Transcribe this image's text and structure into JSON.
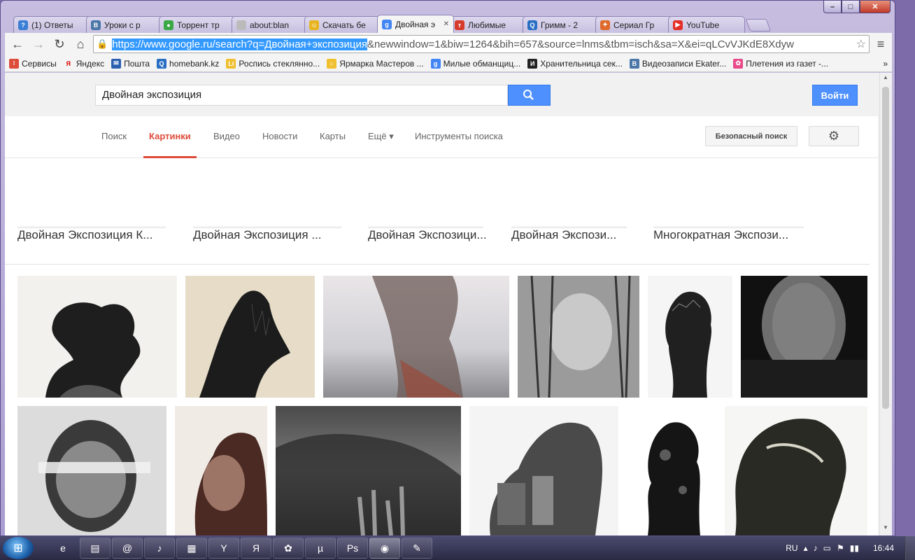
{
  "tabs": [
    {
      "title": "(1) Ответы",
      "icon": "question-icon",
      "icon_color": "#3a7fd5",
      "icon_text": "?"
    },
    {
      "title": "Уроки с р",
      "icon": "vk-icon",
      "icon_color": "#4a76a8",
      "icon_text": "В"
    },
    {
      "title": "Торрент тр",
      "icon": "torrent-icon",
      "icon_color": "#3aa845",
      "icon_text": "●"
    },
    {
      "title": "about:blan",
      "icon": "page-icon",
      "icon_color": "#bbbbbb",
      "icon_text": ""
    },
    {
      "title": "Скачать бе",
      "icon": "smiley-icon",
      "icon_color": "#e8b520",
      "icon_text": "☺"
    },
    {
      "title": "Двойная э",
      "icon": "google-icon",
      "icon_color": "#4285f4",
      "icon_text": "g",
      "active": true
    },
    {
      "title": "Любимые",
      "icon": "t-icon",
      "icon_color": "#d63a2a",
      "icon_text": "т"
    },
    {
      "title": "Гримм - 2",
      "icon": "search-site-icon",
      "icon_color": "#2a6fc4",
      "icon_text": "Q"
    },
    {
      "title": "Сериал Гр",
      "icon": "fox-icon",
      "icon_color": "#e06a2a",
      "icon_text": "✦"
    },
    {
      "title": "YouTube",
      "icon": "youtube-icon",
      "icon_color": "#e52d27",
      "icon_text": "▶"
    }
  ],
  "window_controls": {
    "min": "–",
    "max": "□",
    "close": "✕"
  },
  "toolbar": {
    "back": "←",
    "forward": "→",
    "reload": "↻",
    "home": "⌂",
    "url_selected": "https://www.google.ru/search?q=Двойная+экспозиция",
    "url_rest": "&newwindow=1&biw=1264&bih=657&source=lnms&tbm=isch&sa=X&ei=qLCvVJKdE8Xdyw",
    "lock": "🔒",
    "star": "☆",
    "menu": "≡"
  },
  "bookmarks": [
    {
      "label": "Сервисы",
      "icon": "apps-icon",
      "icon_color": "#dd4b39",
      "icon_text": "⁝"
    },
    {
      "label": "Яндекс",
      "icon": "yandex-icon",
      "icon_color": "#f5f5f5",
      "icon_text": "Я"
    },
    {
      "label": "Пошта",
      "icon": "mail-icon",
      "icon_color": "#2a5fb0",
      "icon_text": "✉"
    },
    {
      "label": "homebank.kz",
      "icon": "search-site-icon",
      "icon_color": "#2a6fc4",
      "icon_text": "Q"
    },
    {
      "label": "Роспись стеклянно...",
      "icon": "li-icon",
      "icon_color": "#f0c030",
      "icon_text": "Li"
    },
    {
      "label": "Ярмарка Мастеров ...",
      "icon": "ring-icon",
      "icon_color": "#f0c030",
      "icon_text": "○"
    },
    {
      "label": "Милые обманщиц...",
      "icon": "google-icon",
      "icon_color": "#4285f4",
      "icon_text": "g"
    },
    {
      "label": "Хранительница сек...",
      "icon": "i-icon",
      "icon_color": "#222222",
      "icon_text": "И"
    },
    {
      "label": "Видеозаписи Ekater...",
      "icon": "vk-icon",
      "icon_color": "#4a76a8",
      "icon_text": "В"
    },
    {
      "label": "Плетения из газет -...",
      "icon": "flower-icon",
      "icon_color": "#e84a8a",
      "icon_text": "✿"
    }
  ],
  "bookmarks_more": "»",
  "search": {
    "query": "Двойная экспозиция",
    "login": "Войти"
  },
  "nav": {
    "items": [
      {
        "label": "Поиск"
      },
      {
        "label": "Картинки",
        "active": true
      },
      {
        "label": "Видео"
      },
      {
        "label": "Новости"
      },
      {
        "label": "Карты"
      },
      {
        "label": "Ещё ▾"
      },
      {
        "label": "Инструменты поиска"
      }
    ],
    "safe_search": "Безопасный поиск",
    "gear": "⚙"
  },
  "related": [
    {
      "label": "Двойная Экспозиция К..."
    },
    {
      "label": "Двойная Экспозиция ..."
    },
    {
      "label": "Двойная Экспозици..."
    },
    {
      "label": "Двойная Экспози..."
    },
    {
      "label": "Многократная Экспози..."
    }
  ],
  "taskbar": {
    "start": "⊞",
    "apps": [
      {
        "name": "ie-icon",
        "glyph": "e"
      },
      {
        "name": "explorer-icon",
        "glyph": "▤"
      },
      {
        "name": "mail-agent-icon",
        "glyph": "@"
      },
      {
        "name": "media-icon",
        "glyph": "♪"
      },
      {
        "name": "calc-icon",
        "glyph": "▦"
      },
      {
        "name": "yandex-browser-icon",
        "glyph": "Y"
      },
      {
        "name": "yandex-icon",
        "glyph": "Я"
      },
      {
        "name": "icq-icon",
        "glyph": "✿"
      },
      {
        "name": "utorrent-icon",
        "glyph": "µ"
      },
      {
        "name": "photoshop-icon",
        "glyph": "Ps"
      },
      {
        "name": "chrome-icon",
        "glyph": "◉"
      },
      {
        "name": "paint-icon",
        "glyph": "✎"
      }
    ],
    "lang": "RU",
    "tray": [
      "▴",
      "♪",
      "▭",
      "⚑",
      "▮▮"
    ],
    "time": "16:44"
  }
}
